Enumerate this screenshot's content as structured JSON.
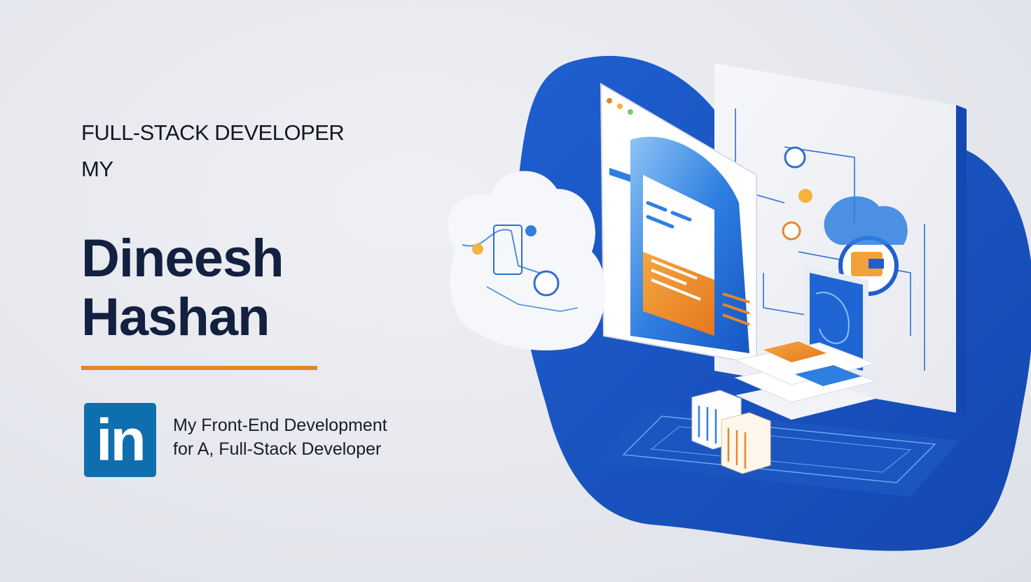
{
  "headline": {
    "role_line_1": "FULL-STACK DEVELOPER",
    "role_line_2": "MY"
  },
  "name": {
    "first": "Dineesh",
    "last": "Hashan"
  },
  "social": {
    "logo_text": "in",
    "tagline_line_1": "My Front-End Development",
    "tagline_line_2": "for A, Full-Stack Developer"
  },
  "colors": {
    "accent_orange": "#e8862a",
    "brand_blue": "#1a56c4",
    "name_navy": "#13203f",
    "linkedin_blue": "#0f6fae"
  },
  "illustration": {
    "icons": [
      "cloud-icon",
      "browser-window-icon",
      "diagram-panel-icon",
      "tablet-icon",
      "server-stack-icon"
    ]
  }
}
